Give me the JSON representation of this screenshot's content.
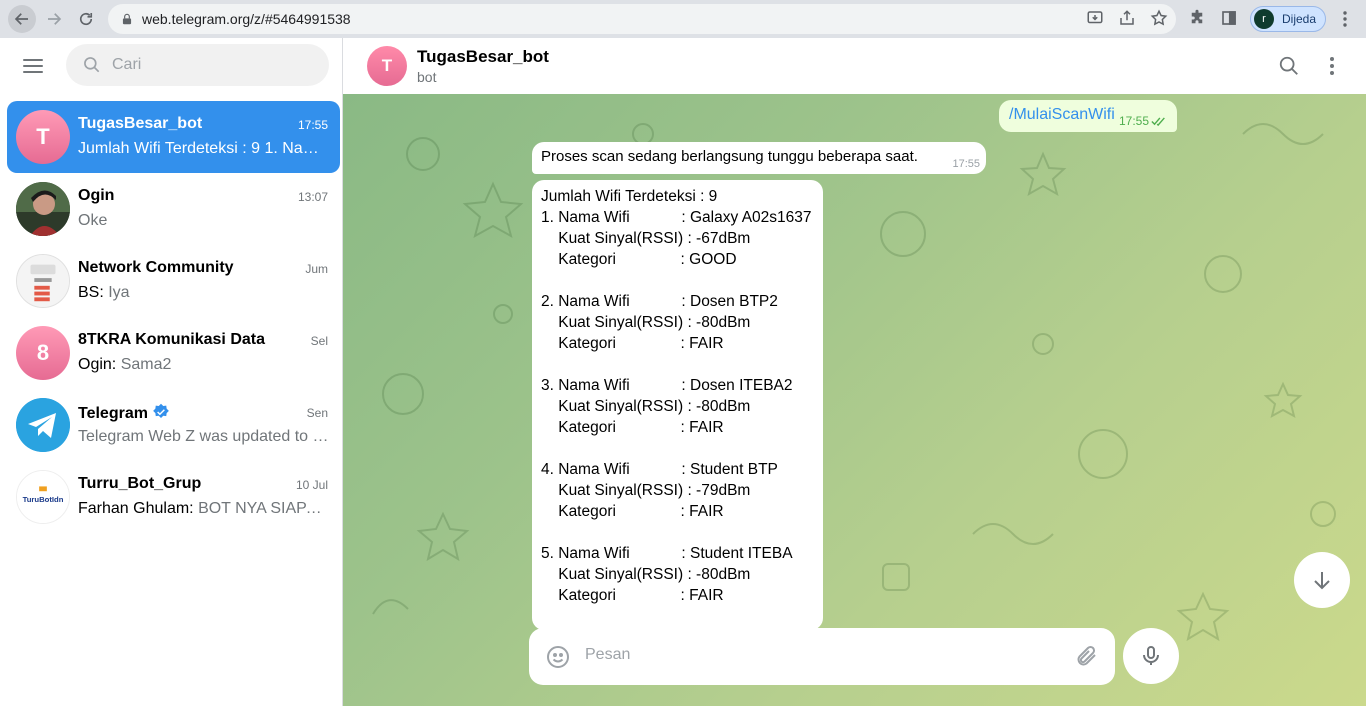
{
  "browser": {
    "url": "web.telegram.org/z/#5464991538",
    "profile_initial": "r",
    "profile_name": "Dijeda"
  },
  "sidebar": {
    "search_placeholder": "Cari",
    "chats": [
      {
        "name": "TugasBesar_bot",
        "time": "17:55",
        "sender": "",
        "preview": "Jumlah Wifi Terdeteksi : 9 1. Nama Wifi",
        "avatar_letter": "T",
        "active": true
      },
      {
        "name": "Ogin",
        "time": "13:07",
        "sender": "",
        "preview": "Oke",
        "avatar_letter": "",
        "active": false
      },
      {
        "name": "Network Community",
        "time": "Jum",
        "sender": "BS: ",
        "preview": "Iya",
        "avatar_letter": "",
        "active": false
      },
      {
        "name": "8TKRA Komunikasi Data",
        "time": "Sel",
        "sender": "Ogin: ",
        "preview": "Sama2",
        "avatar_letter": "8",
        "active": false
      },
      {
        "name": "Telegram",
        "time": "Sen",
        "sender": "",
        "preview": "Telegram Web Z was updated to version",
        "avatar_letter": "",
        "active": false
      },
      {
        "name": "Turru_Bot_Grup",
        "time": "10 Jul",
        "sender": "Farhan Ghulam: ",
        "preview": "BOT NYA SIAPA YANG BUAT",
        "avatar_letter": "",
        "active": false
      }
    ],
    "turru_logo_text": "TuruBotIdn"
  },
  "chat_header": {
    "avatar_letter": "T",
    "title": "TugasBesar_bot",
    "subtitle": "bot"
  },
  "messages": {
    "out_1": {
      "text": "/MulaiScanWifi",
      "time": "17:55"
    },
    "in_1": {
      "text": "Proses scan sedang berlangsung tunggu beberapa saat.",
      "time": "17:55"
    },
    "in_2_lines": [
      "Jumlah Wifi Terdeteksi : 9",
      "1. Nama Wifi            : Galaxy A02s1637",
      "    Kuat Sinyal(RSSI) : -67dBm",
      "    Kategori               : GOOD",
      "",
      "2. Nama Wifi            : Dosen BTP2",
      "    Kuat Sinyal(RSSI) : -80dBm",
      "    Kategori               : FAIR",
      "",
      "3. Nama Wifi            : Dosen ITEBA2",
      "    Kuat Sinyal(RSSI) : -80dBm",
      "    Kategori               : FAIR",
      "",
      "4. Nama Wifi            : Student BTP",
      "    Kuat Sinyal(RSSI) : -79dBm",
      "    Kategori               : FAIR",
      "",
      "5. Nama Wifi            : Student ITEBA",
      "    Kuat Sinyal(RSSI) : -80dBm",
      "    Kategori               : FAIR"
    ]
  },
  "composer": {
    "placeholder": "Pesan"
  },
  "colors": {
    "accent": "#3390ec",
    "outgoing_bubble": "#effedd",
    "avatar_pink": "#e66b93"
  }
}
